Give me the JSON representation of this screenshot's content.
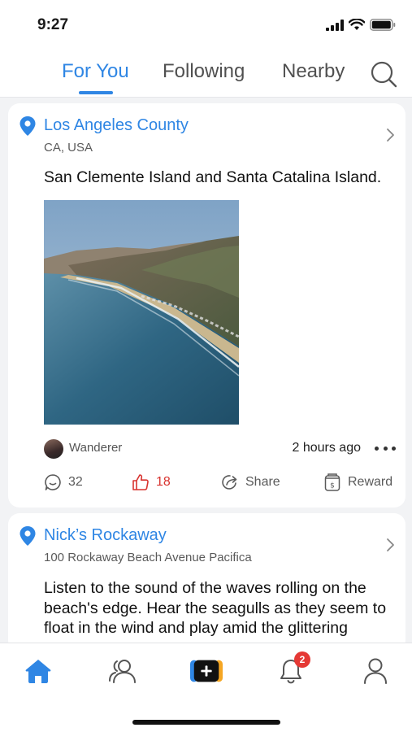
{
  "status_bar": {
    "time": "9:27"
  },
  "top_nav": {
    "tabs": [
      {
        "label": "For You",
        "active": true
      },
      {
        "label": "Following",
        "active": false
      },
      {
        "label": "Nearby",
        "active": false
      }
    ],
    "search_icon": "search-icon"
  },
  "posts": [
    {
      "location_name": "Los Angeles County",
      "location_sub": "CA, USA",
      "text": "San Clemente Island and Santa Catalina Island.",
      "author": "Wanderer",
      "time_ago": "2 hours ago",
      "comments": "32",
      "likes": "18",
      "share_label": "Share",
      "reward_label": "Reward"
    },
    {
      "location_name": "Nick’s Rockaway",
      "location_sub": "100 Rockaway Beach Avenue Pacifica",
      "text": "Listen to the sound of the waves rolling on the beach's edge. Hear the seagulls as they seem to float in the wind and play amid the glittering"
    }
  ],
  "bottom_nav": {
    "items": [
      "home-icon",
      "friends-icon",
      "create-icon",
      "notifications-icon",
      "profile-icon"
    ],
    "notification_count": "2"
  },
  "colors": {
    "accent": "#2f86e4",
    "like": "#d8332f",
    "badge": "#e53935"
  }
}
